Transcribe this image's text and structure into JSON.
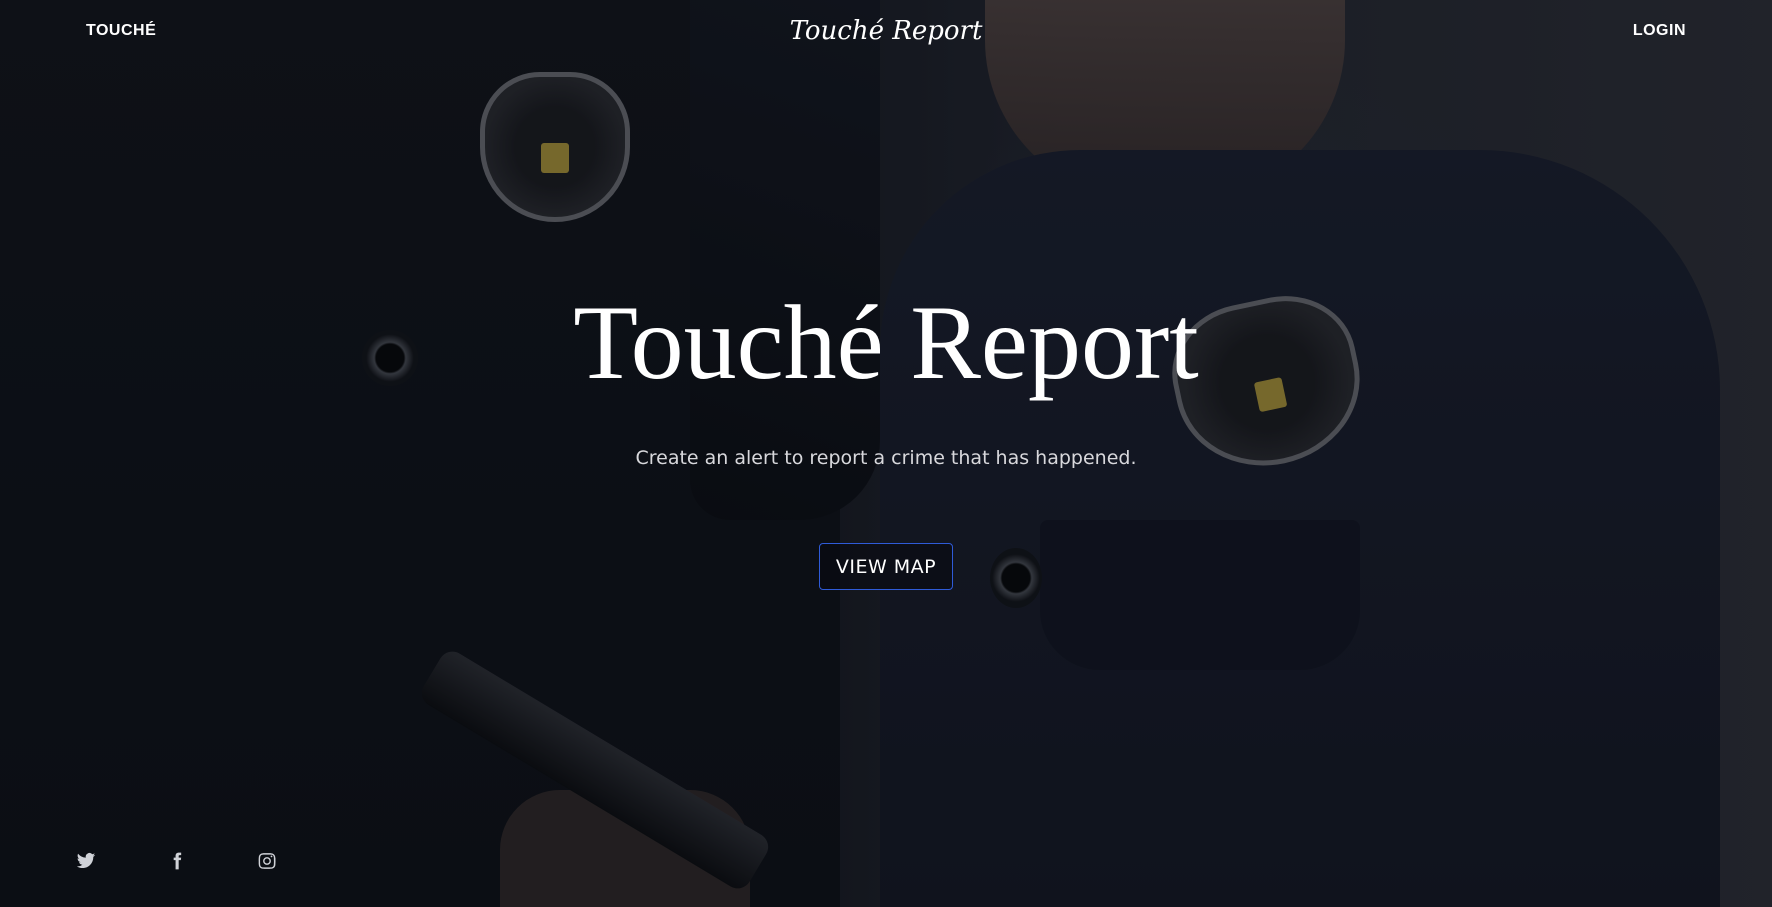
{
  "nav": {
    "brand": "TOUCHÉ",
    "title": "Touché Report",
    "login": "LOGIN"
  },
  "hero": {
    "title": "Touché Report",
    "subtitle": "Create an alert to report a crime that has happened.",
    "cta_label": "VIEW MAP"
  },
  "social": {
    "icons": [
      "twitter-icon",
      "facebook-icon",
      "instagram-icon"
    ]
  },
  "colors": {
    "accent_border": "#2f5bd8",
    "text": "#ffffff"
  }
}
